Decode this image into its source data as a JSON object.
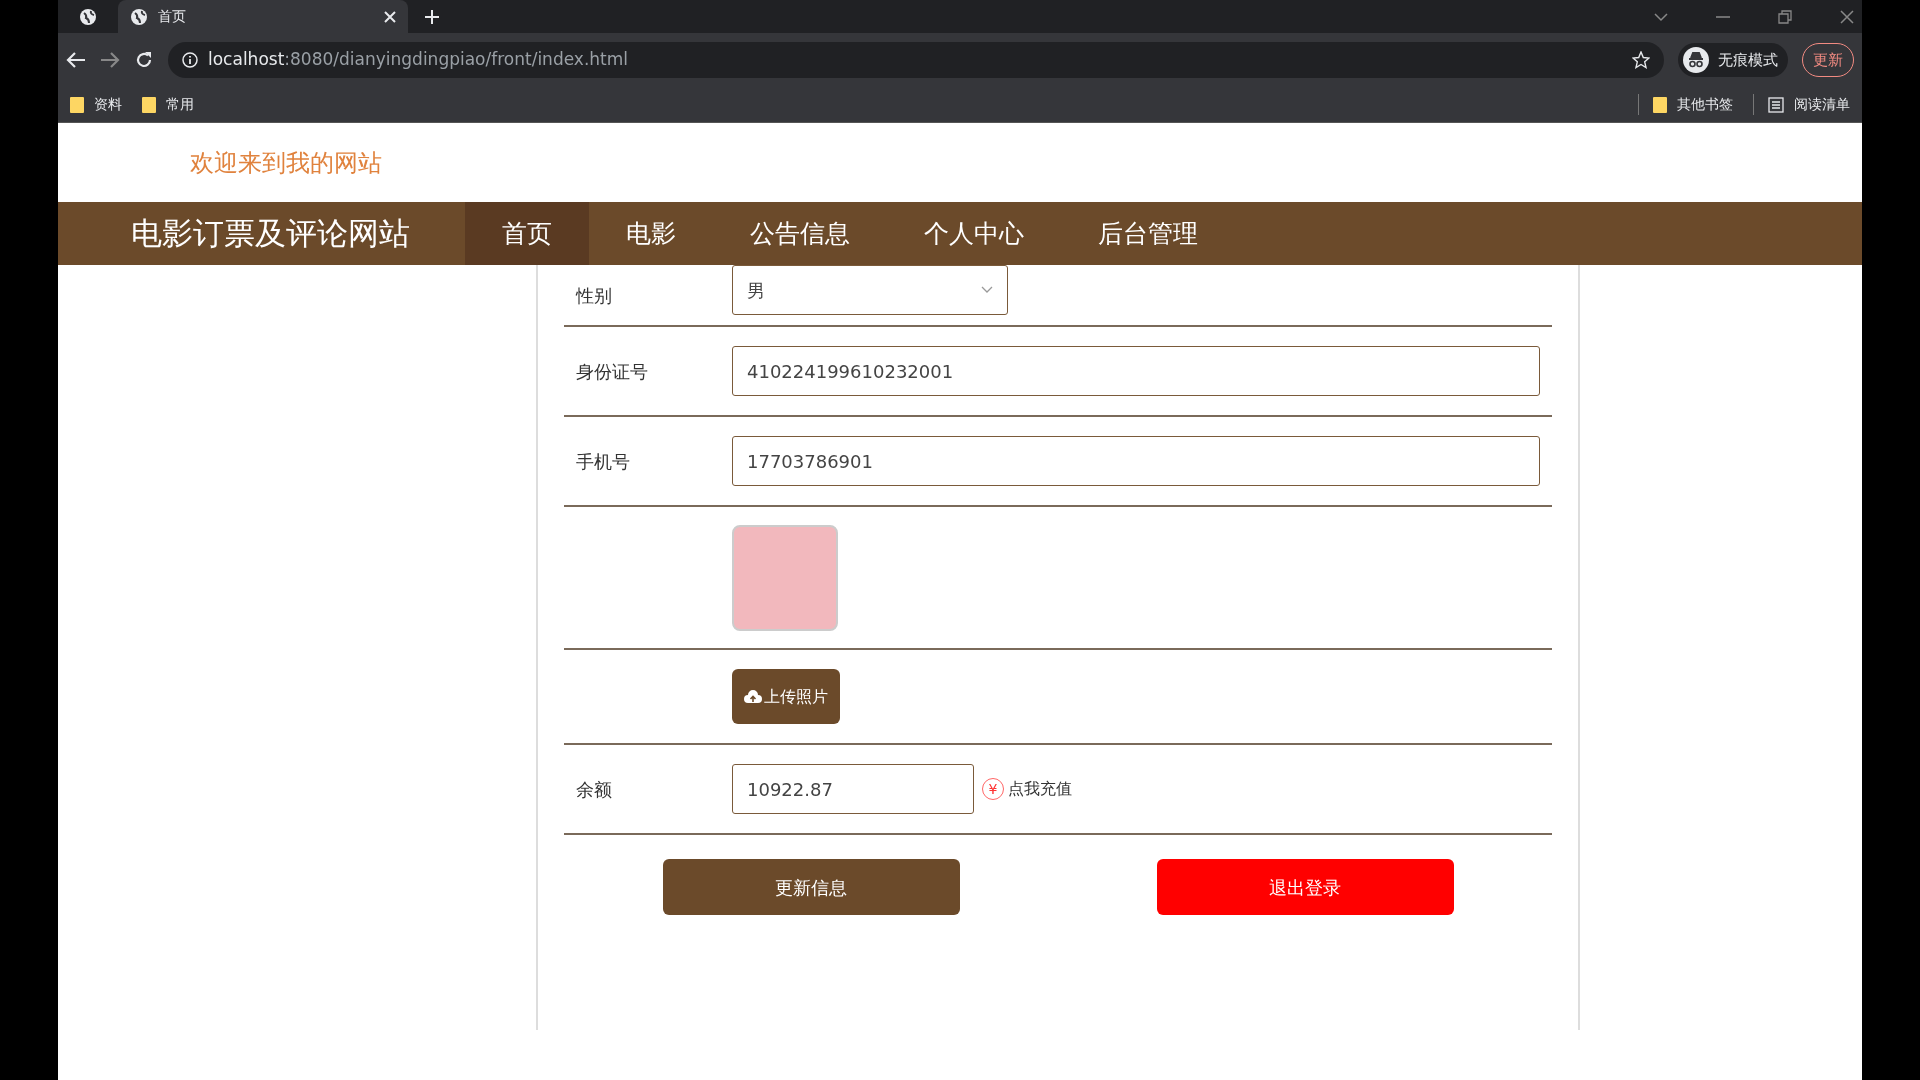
{
  "browser": {
    "tabs": [
      {
        "title": "首页",
        "selected": true
      }
    ],
    "url_host": "localhost",
    "url_rest": ":8080/dianyingdingpiao/front/index.html",
    "incognito_label": "无痕模式",
    "update_button": "更新",
    "bookmarks": [
      "资料",
      "常用"
    ],
    "other_bookmarks": "其他书签",
    "reading_list": "阅读清单"
  },
  "site": {
    "welcome": "欢迎来到我的网站",
    "brand": "电影订票及评论网站",
    "nav": [
      {
        "label": "首页",
        "selected": true
      },
      {
        "label": "电影",
        "selected": false
      },
      {
        "label": "公告信息",
        "selected": false
      },
      {
        "label": "个人中心",
        "selected": false
      },
      {
        "label": "后台管理",
        "selected": false
      }
    ]
  },
  "form": {
    "rows": [
      {
        "kind": "select",
        "label": "性别",
        "value": "男"
      },
      {
        "kind": "input",
        "label": "身份证号",
        "value": "410224199610232001"
      },
      {
        "kind": "input",
        "label": "手机号",
        "value": "17703786901"
      },
      {
        "kind": "photo"
      },
      {
        "kind": "upload",
        "button": "上传照片"
      },
      {
        "kind": "balance",
        "label": "余额",
        "value": "10922.87",
        "link_icon": "¥",
        "link": "点我充值"
      }
    ],
    "buttons": [
      {
        "kind": "primary",
        "label": "更新信息"
      },
      {
        "kind": "danger",
        "label": "退出登录"
      }
    ]
  }
}
